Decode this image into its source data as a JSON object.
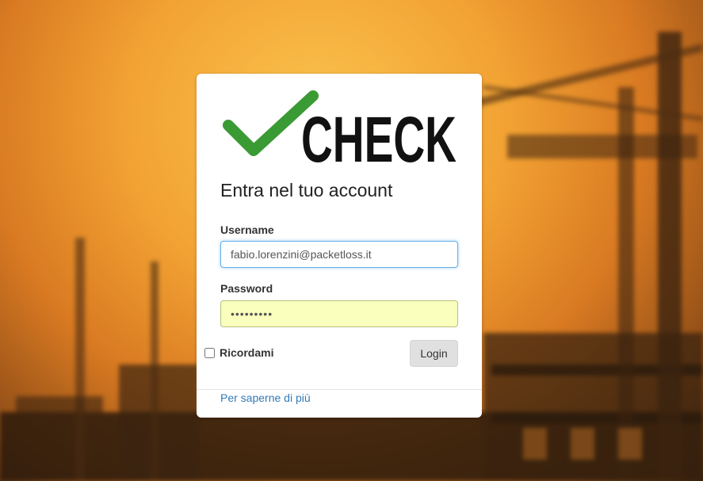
{
  "logo": {
    "text": "CHECK",
    "check_color": "#3a9a34",
    "text_color": "#111111"
  },
  "login": {
    "heading": "Entra nel tuo account",
    "username_label": "Username",
    "username_value": "fabio.lorenzini@packetloss.it",
    "password_label": "Password",
    "password_value": "password1",
    "remember_label": "Ricordami",
    "login_button": "Login",
    "learn_more_link": "Per saperne di più"
  },
  "colors": {
    "link": "#337ab7",
    "autofill": "#faffbd",
    "focus_border": "#66afe9"
  }
}
